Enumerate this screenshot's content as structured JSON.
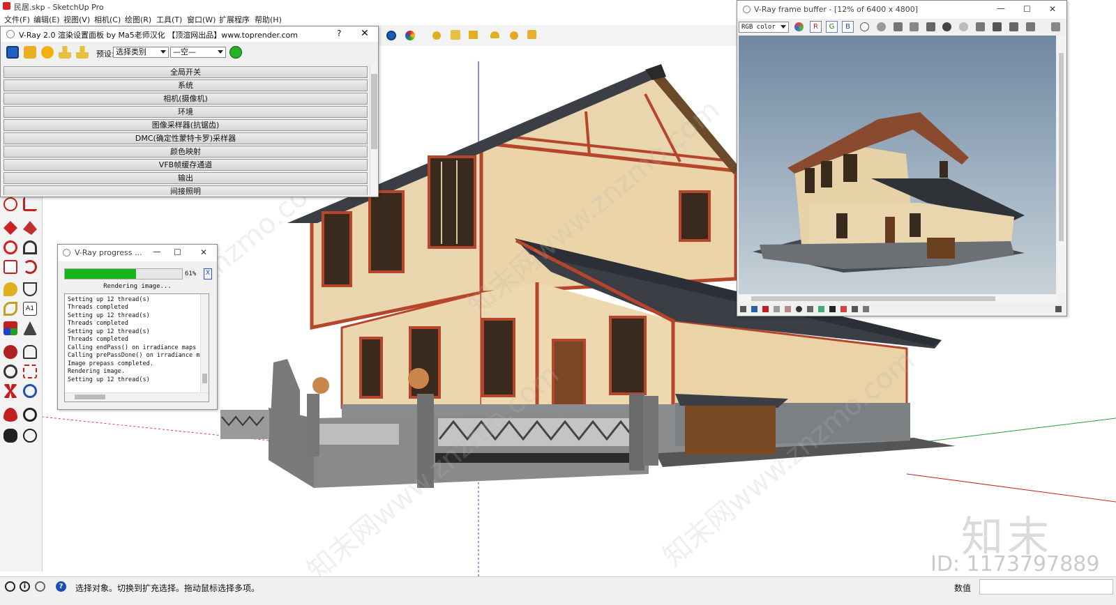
{
  "window": {
    "title": "民居.skp - SketchUp Pro"
  },
  "menu": [
    "文件(F)",
    "编辑(E)",
    "视图(V)",
    "相机(C)",
    "绘图(R)",
    "工具(T)",
    "窗口(W)",
    "扩展程序",
    "帮助(H)"
  ],
  "vray_settings": {
    "title": "V-Ray 2.0 渲染设置面板 by Ma5老师汉化 【顶渲网出品】www.toprender.com",
    "help": "?",
    "close": "✕",
    "preset_label": "预设:",
    "preset_category": "选择类别",
    "preset_value": "—空—",
    "rollouts": [
      "全局开关",
      "系统",
      "相机(摄像机)",
      "环境",
      "图像采样器(抗锯齿)",
      "DMC(确定性蒙特卡罗)采样器",
      "颜色映射",
      "VFB帧缓存通道",
      "输出",
      "间接照明"
    ]
  },
  "progress": {
    "title": "V-Ray progress ...",
    "percent_label": "61%",
    "percent": 0.61,
    "status": "Rendering image...",
    "stop": "X",
    "log": [
      "Setting up 12 thread(s)",
      "Threads completed",
      "Setting up 12 thread(s)",
      "Threads completed",
      "Setting up 12 thread(s)",
      "Threads completed",
      "Calling endPass() on irradiance maps",
      "Calling prePassDone() on irradiance map",
      "Image prepass completed.",
      "Rendering image.",
      "Setting up 12 thread(s)"
    ]
  },
  "vfb": {
    "title": "V-Ray frame buffer - [12% of 6400 x 4800]",
    "channel": "RGB color",
    "r": "R",
    "g": "G",
    "b": "B",
    "minimize": "—",
    "maximize": "☐",
    "close": "✕"
  },
  "status": {
    "hint": "选择对象。切换到扩充选择。拖动鼠标选择多项。",
    "measure_label": "数值",
    "measure_value": ""
  },
  "watermark": {
    "logo": "知末",
    "id": "ID: 1173797889",
    "text": "知末网www.znzmo.com"
  }
}
